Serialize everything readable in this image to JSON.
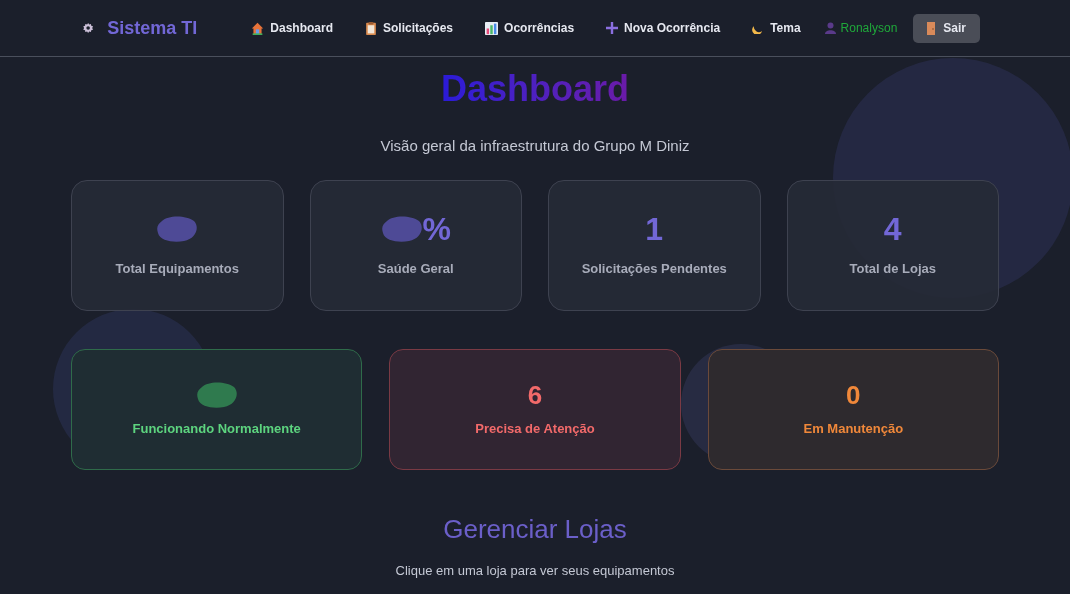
{
  "brand": {
    "name": "Sistema TI"
  },
  "nav": [
    {
      "label": "Dashboard",
      "kind": "house"
    },
    {
      "label": "Solicitações",
      "kind": "clipboard"
    },
    {
      "label": "Ocorrências",
      "kind": "chart"
    },
    {
      "label": "Nova Ocorrência",
      "kind": "plus"
    },
    {
      "label": "Tema",
      "kind": "moon"
    }
  ],
  "user": {
    "name": "Ronalyson"
  },
  "logout": {
    "label": "Sair"
  },
  "page": {
    "title": "Dashboard",
    "subtitle": "Visão geral da infraestrutura do Grupo M Diniz"
  },
  "stats": [
    {
      "label": "Total Equipamentos",
      "obscured": true
    },
    {
      "label": "Saúde Geral",
      "value": "%",
      "obscured": true
    },
    {
      "label": "Solicitações Pendentes",
      "value": "1",
      "obscured": false
    },
    {
      "label": "Total de Lojas",
      "value": "4",
      "obscured": false
    }
  ],
  "status_cards": [
    {
      "label": "Funcionando Normalmente",
      "obscured": true,
      "kind": "ok"
    },
    {
      "label": "Precisa de Atenção",
      "value": "6",
      "obscured": false,
      "kind": "alert"
    },
    {
      "label": "Em Manutenção",
      "value": "0",
      "obscured": false,
      "kind": "maintenance"
    }
  ],
  "stores": {
    "title": "Gerenciar Lojas",
    "subtitle": "Clique em uma loja para ver seus equipamentos"
  }
}
